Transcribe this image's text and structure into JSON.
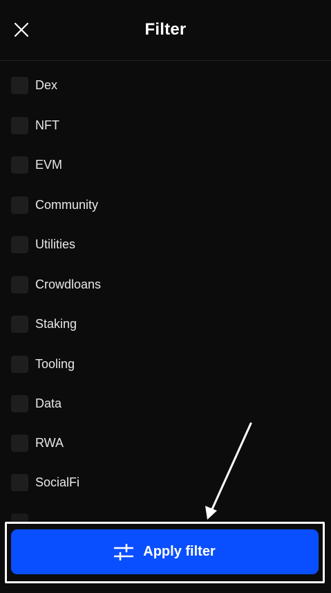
{
  "header": {
    "title": "Filter",
    "close_icon": "close-icon"
  },
  "filter_options": [
    {
      "label": "Dex",
      "checked": false
    },
    {
      "label": "NFT",
      "checked": false
    },
    {
      "label": "EVM",
      "checked": false
    },
    {
      "label": "Community",
      "checked": false
    },
    {
      "label": "Utilities",
      "checked": false
    },
    {
      "label": "Crowdloans",
      "checked": false
    },
    {
      "label": "Staking",
      "checked": false
    },
    {
      "label": "Tooling",
      "checked": false
    },
    {
      "label": "Data",
      "checked": false
    },
    {
      "label": "RWA",
      "checked": false
    },
    {
      "label": "SocialFi",
      "checked": false
    }
  ],
  "footer": {
    "apply_label": "Apply filter",
    "apply_icon": "sliders-icon"
  },
  "colors": {
    "background": "#0c0c0c",
    "accent": "#0a4fff",
    "checkbox": "#1e1e1e",
    "annotation": "#ffffff"
  }
}
